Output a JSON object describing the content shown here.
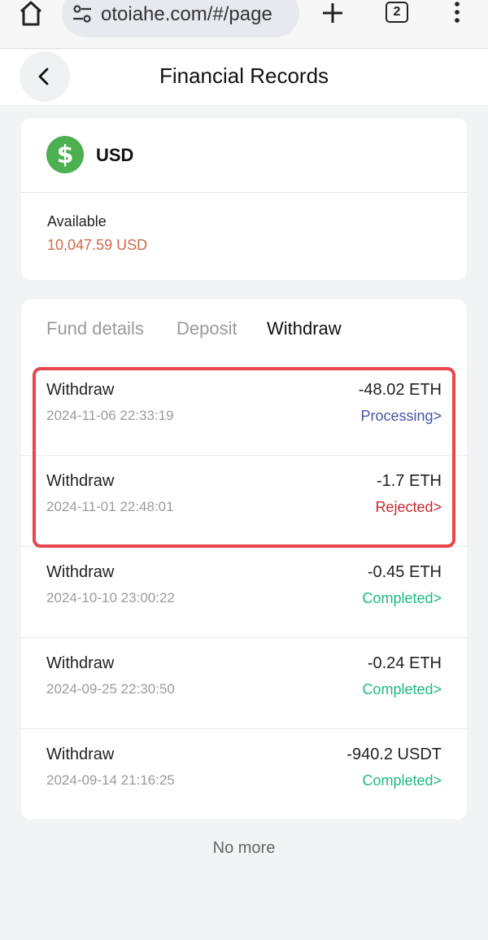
{
  "browser": {
    "url": "otoiahe.com/#/page",
    "tab_count": "2"
  },
  "header": {
    "title": "Financial Records"
  },
  "balance": {
    "currency": "USD",
    "available_label": "Available",
    "available_value": "10,047.59 USD"
  },
  "tabs": [
    {
      "label": "Fund details"
    },
    {
      "label": "Deposit"
    },
    {
      "label": "Withdraw"
    }
  ],
  "records": [
    {
      "type": "Withdraw",
      "time": "2024-11-06 22:33:19",
      "amount": "-48.02 ETH",
      "status": "Processing>"
    },
    {
      "type": "Withdraw",
      "time": "2024-11-01 22:48:01",
      "amount": "-1.7 ETH",
      "status": "Rejected>"
    },
    {
      "type": "Withdraw",
      "time": "2024-10-10 23:00:22",
      "amount": "-0.45 ETH",
      "status": "Completed>"
    },
    {
      "type": "Withdraw",
      "time": "2024-09-25 22:30:50",
      "amount": "-0.24 ETH",
      "status": "Completed>"
    },
    {
      "type": "Withdraw",
      "time": "2024-09-14 21:16:25",
      "amount": "-940.2 USDT",
      "status": "Completed>"
    }
  ],
  "footer": {
    "no_more": "No more"
  },
  "colors": {
    "processing": "#4a55a8",
    "rejected": "#c8282e",
    "completed": "#1fb885",
    "available": "#d0694d",
    "highlight": "#e8454c",
    "coin": "#4caf50"
  },
  "icons": {
    "home": "home-icon",
    "site_settings": "tune-icon",
    "new_tab": "plus-icon",
    "tab_switcher": "tab-count-icon",
    "menu": "more-vert-icon",
    "back": "chevron-left-icon",
    "currency": "dollar-coin-icon"
  }
}
